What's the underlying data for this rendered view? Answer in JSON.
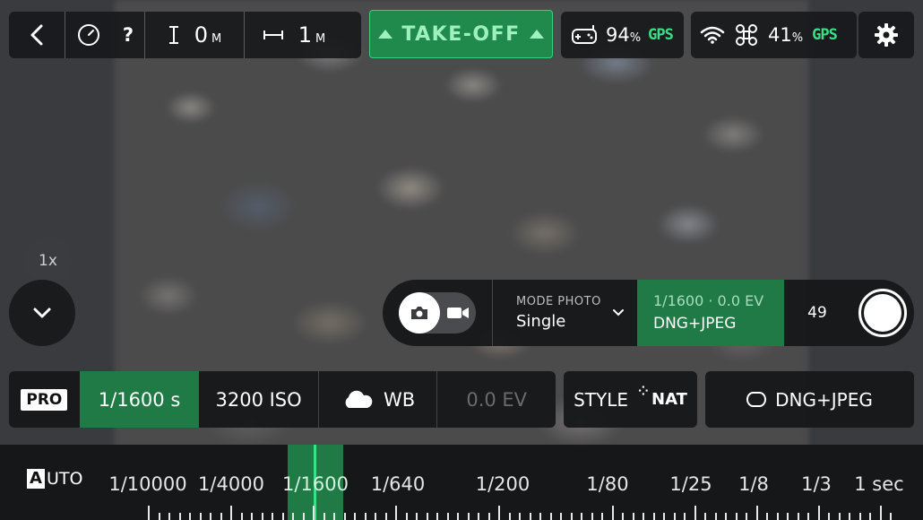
{
  "topbar": {
    "help_label": "?",
    "altitude": {
      "value": "0",
      "unit": "M"
    },
    "distance": {
      "value": "1",
      "unit": "M"
    },
    "takeoff_label": "TAKE-OFF",
    "controller": {
      "battery_value": "94",
      "battery_unit": "%",
      "gps_label": "GPS"
    },
    "drone": {
      "battery_value": "41",
      "battery_unit": "%",
      "gps_label": "GPS"
    }
  },
  "zoom": {
    "label": "1x"
  },
  "capture": {
    "mode_label": "MODE PHOTO",
    "mode_value": "Single",
    "exposure_summary": "1/1600 · 0.0 EV",
    "format": "DNG+JPEG",
    "shots_remaining": "49"
  },
  "settings": {
    "pro_label": "PRO",
    "shutter": "1/1600 s",
    "iso": "3200 ISO",
    "wb_label": "WB",
    "ev": "0.0 EV",
    "style_label": "STYLE",
    "style_value": "NAT",
    "format_label": "DNG+JPEG"
  },
  "ruler": {
    "auto_first": "A",
    "auto_rest": "UTO",
    "labels": [
      "1/10000",
      "1/4000",
      "1/1600",
      "1/640",
      "1/200",
      "1/80",
      "1/25",
      "1/8",
      "1/3",
      "1 sec"
    ],
    "selected": "1/1600"
  },
  "colors": {
    "accent": "#1f7a45",
    "accent_text": "#3ae085",
    "panel": "#18191b"
  }
}
